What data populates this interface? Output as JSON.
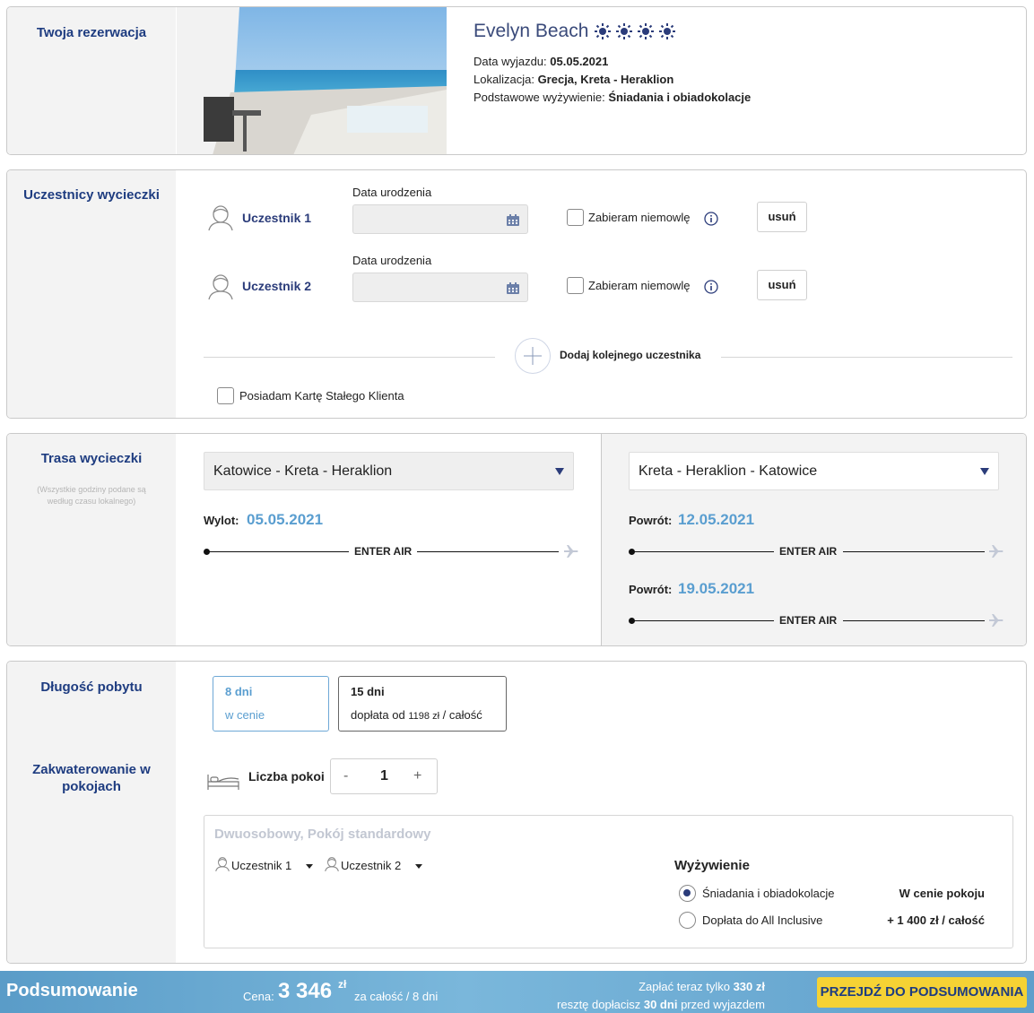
{
  "reservation": {
    "section_title": "Twoja rezerwacja",
    "hotel_name": "Evelyn Beach",
    "stars": 4,
    "departure_label": "Data wyjazdu:",
    "departure_value": "05.05.2021",
    "location_label": "Lokalizacja:",
    "location_value": "Grecja, Kreta - Heraklion",
    "board_label": "Podstawowe wyżywienie:",
    "board_value": "Śniadania i obiadokolacje"
  },
  "participants": {
    "section_title": "Uczestnicy wycieczki",
    "items": [
      {
        "name": "Uczestnik 1",
        "dob_label": "Data urodzenia",
        "dob_value": "",
        "infant_label": "Zabieram niemowlę",
        "remove_label": "usuń"
      },
      {
        "name": "Uczestnik 2",
        "dob_label": "Data urodzenia",
        "dob_value": "",
        "infant_label": "Zabieram niemowlę",
        "remove_label": "usuń"
      }
    ],
    "add_label": "Dodaj kolejnego uczestnika",
    "loyalty_label": "Posiadam Kartę Stałego Klienta"
  },
  "route": {
    "section_title": "Trasa wycieczki",
    "note": "(Wszystkie godziny podane są według czasu lokalnego)",
    "outbound": {
      "route": "Katowice - Kreta - Heraklion",
      "label": "Wylot:",
      "date": "05.05.2021",
      "carrier": "ENTER AIR"
    },
    "return": {
      "route": "Kreta - Heraklion - Katowice",
      "options": [
        {
          "label": "Powrót:",
          "date": "12.05.2021",
          "carrier": "ENTER AIR"
        },
        {
          "label": "Powrót:",
          "date": "19.05.2021",
          "carrier": "ENTER AIR"
        }
      ]
    }
  },
  "duration": {
    "section_title": "Długość pobytu",
    "options": [
      {
        "days": "8 dni",
        "price": "w cenie"
      },
      {
        "days": "15 dni",
        "price_prefix": "dopłata od",
        "price_amount": "1198 zł",
        "price_suffix": "/ całość"
      }
    ]
  },
  "accommodation": {
    "section_title": "Zakwaterowanie w pokojach",
    "rooms_label": "Liczba pokoi",
    "rooms_value": "1",
    "minus": "-",
    "plus": "+",
    "room_title": "Dwuosobowy, Pokój standardowy",
    "room_participants": [
      "Uczestnik 1",
      "Uczestnik 2"
    ],
    "meal_title": "Wyżywienie",
    "meal_options": [
      {
        "label": "Śniadania i obiadokolacje",
        "price": "W cenie pokoju",
        "selected": true
      },
      {
        "label": "Dopłata do All Inclusive",
        "price": "+ 1 400 zł / całość",
        "selected": false
      }
    ]
  },
  "summary": {
    "title": "Podsumowanie",
    "price_label": "Cena:",
    "price_value": "3 346",
    "currency": "zł",
    "price_scope": "za całość / 8 dni",
    "pay_now_prefix": "Zapłać teraz tylko",
    "pay_now_amount": "330 zł",
    "pay_rest_prefix": "resztę dopłacisz",
    "pay_rest_days": "30 dni",
    "pay_rest_suffix": "przed wyjazdem",
    "cta": "PRZEJDŹ DO PODSUMOWANIA"
  },
  "colors": {
    "navy": "#1e3c80",
    "accent_blue": "#5a9ed0",
    "cta_yellow": "#f5d234"
  }
}
